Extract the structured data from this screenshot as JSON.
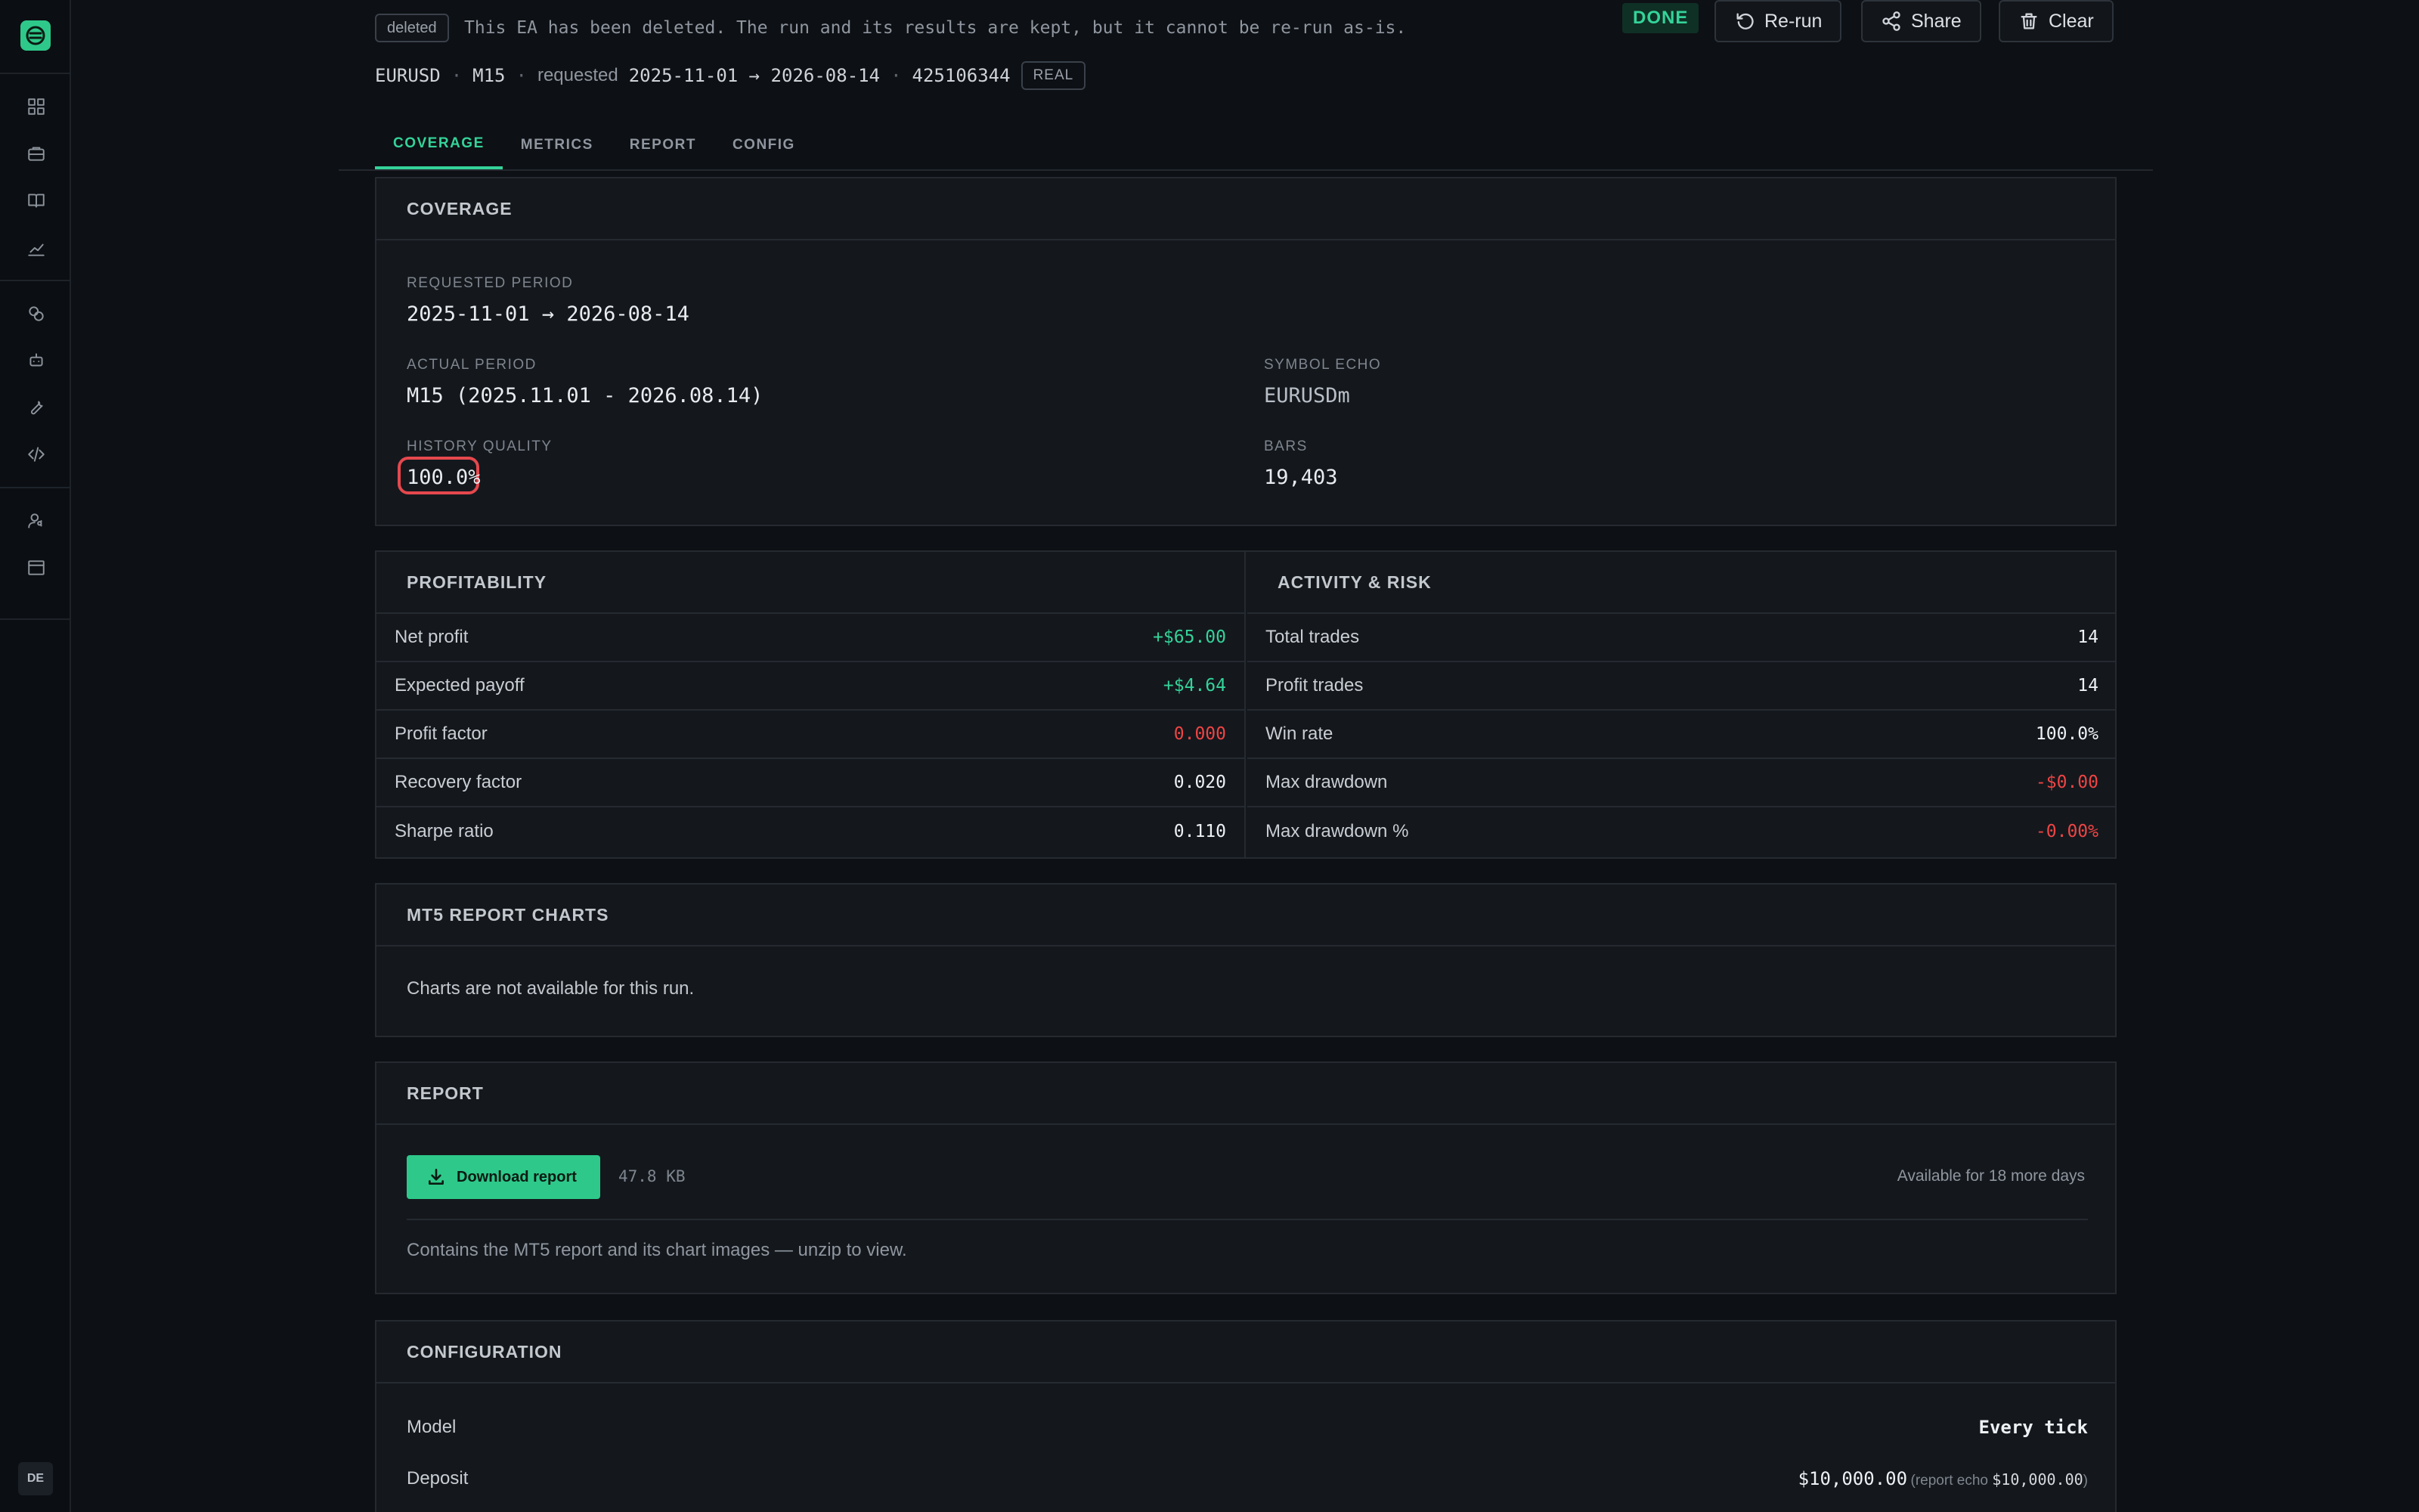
{
  "header": {
    "deleted_badge": "deleted",
    "deleted_note": "This EA has been deleted. The run and its results are kept, but it cannot be re-run as-is.",
    "status": "DONE",
    "rerun_label": "Re-run",
    "share_label": "Share",
    "clear_label": "Clear",
    "symbol": "EURUSD",
    "timeframe": "M15",
    "requested_label": "requested",
    "requested_range": "2025-11-01 → 2026-08-14",
    "account": "425106344",
    "account_type": "REAL"
  },
  "tabs": [
    "COVERAGE",
    "METRICS",
    "REPORT",
    "CONFIG"
  ],
  "coverage": {
    "title": "COVERAGE",
    "requested_period_label": "REQUESTED PERIOD",
    "requested_period": "2025-11-01 → 2026-08-14",
    "actual_period_label": "ACTUAL PERIOD",
    "actual_period": "M15 (2025.11.01 - 2026.08.14)",
    "symbol_echo_label": "SYMBOL ECHO",
    "symbol_echo": "EURUSDm",
    "history_quality_label": "HISTORY QUALITY",
    "history_quality": "100.0%",
    "bars_label": "BARS",
    "bars": "19,403"
  },
  "profitability": {
    "title": "PROFITABILITY",
    "rows": [
      {
        "label": "Net profit",
        "value": "+$65.00"
      },
      {
        "label": "Expected payoff",
        "value": "+$4.64"
      },
      {
        "label": "Profit factor",
        "value": "0.000"
      },
      {
        "label": "Recovery factor",
        "value": "0.020"
      },
      {
        "label": "Sharpe ratio",
        "value": "0.110"
      }
    ]
  },
  "activity": {
    "title": "ACTIVITY & RISK",
    "rows": [
      {
        "label": "Total trades",
        "value": "14"
      },
      {
        "label": "Profit trades",
        "value": "14"
      },
      {
        "label": "Win rate",
        "value": "100.0%"
      },
      {
        "label": "Max drawdown",
        "value": "-$0.00"
      },
      {
        "label": "Max drawdown %",
        "value": "-0.00%"
      }
    ]
  },
  "charts": {
    "title": "MT5 REPORT CHARTS",
    "message": "Charts are not available for this run."
  },
  "report": {
    "title": "REPORT",
    "download_label": "Download report",
    "size": "47.8 KB",
    "availability": "Available for 18 more days",
    "note": "Contains the MT5 report and its chart images — unzip to view."
  },
  "configuration": {
    "title": "CONFIGURATION",
    "model_label": "Model",
    "model_value": "Every tick",
    "deposit_label": "Deposit",
    "deposit_value": "$10,000.00",
    "deposit_echo_prefix": "(report echo",
    "deposit_echo_value": "$10,000.00",
    "deposit_echo_suffix": ")"
  },
  "sidebar": {
    "language": "DE",
    "icons": [
      "dashboard-icon",
      "briefcase-icon",
      "book-icon",
      "chart-line-icon",
      "coins-icon",
      "robot-icon",
      "wrench-icon",
      "code-icon",
      "user-settings-icon",
      "archive-icon"
    ]
  },
  "colors": {
    "accent": "#34d399",
    "negative": "#ef4444",
    "highlight_ring": "#e5484d",
    "background": "#0d1014",
    "card": "#14181d"
  }
}
